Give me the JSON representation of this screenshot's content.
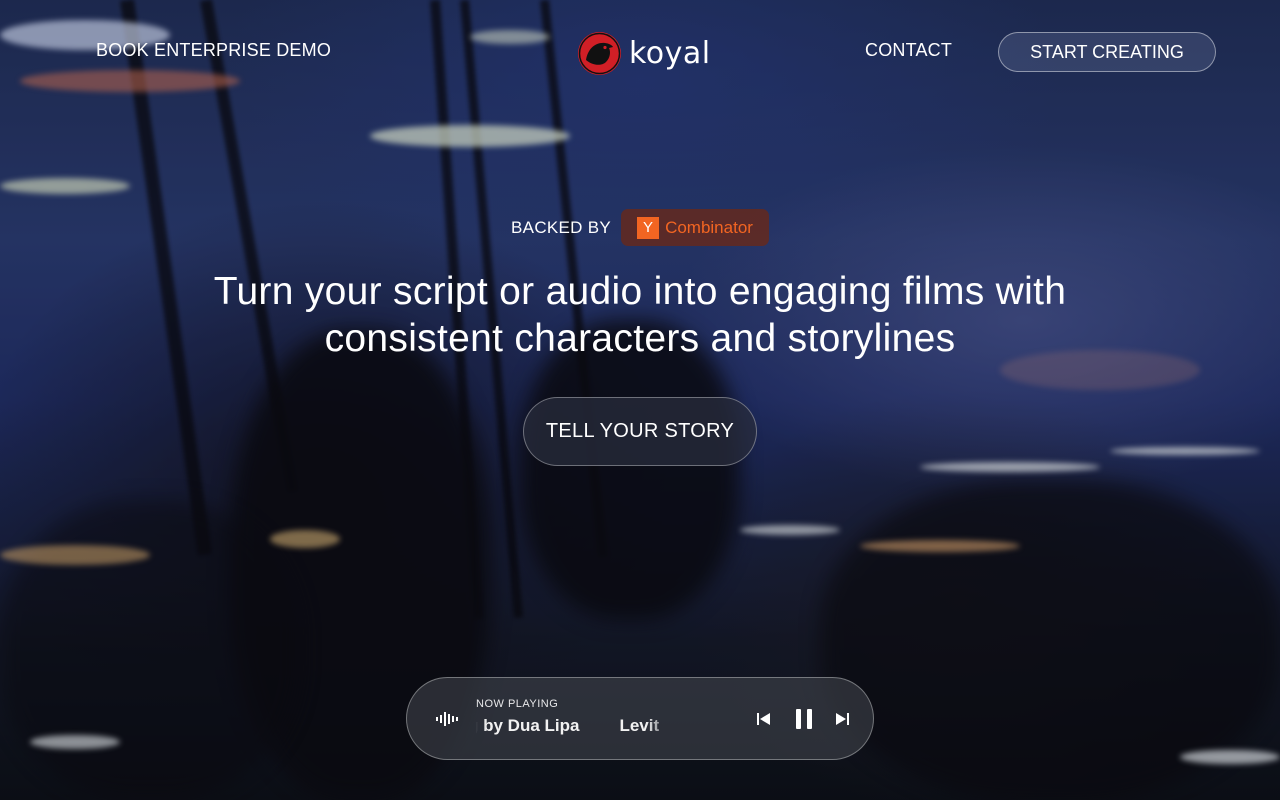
{
  "header": {
    "demo_link": "BOOK ENTERPRISE DEMO",
    "logo_text": "koyal",
    "contact_link": "CONTACT",
    "start_button": "START CREATING"
  },
  "hero": {
    "backed_by_label": "BACKED BY",
    "yc_letter": "Y",
    "yc_name": "Combinator",
    "headline_line1": "Turn your script or audio into engaging films with",
    "headline_line2": "consistent characters and storylines",
    "cta_label": "TELL YOUR STORY"
  },
  "player": {
    "now_playing_label": "NOW PLAYING",
    "ticker_visible_1": "g by Dua Lipa",
    "ticker_visible_2": "Levit",
    "state": "playing"
  },
  "colors": {
    "brand_red": "#d11f26",
    "yc_orange": "#f26522"
  },
  "icons": [
    "koyal-bird-logo-icon",
    "waveform-icon",
    "skip-previous-icon",
    "pause-icon",
    "skip-next-icon"
  ]
}
